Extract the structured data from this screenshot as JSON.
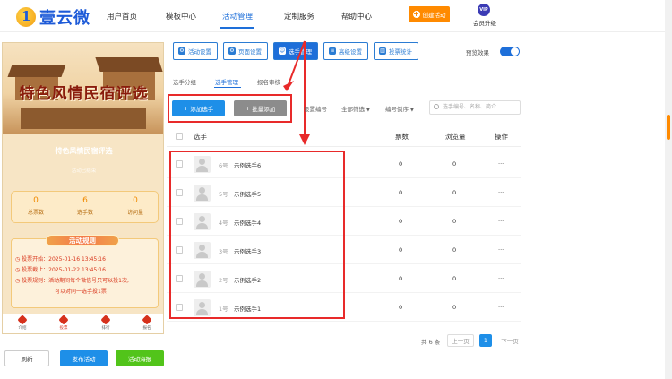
{
  "header": {
    "logo_text": "壹云微",
    "logo_mark": "1",
    "nav": [
      "用户首页",
      "模板中心",
      "活动管理",
      "定制服务",
      "帮助中心"
    ],
    "create_label": "创建活动",
    "vip_badge": "VIP",
    "vip_label": "会员升级"
  },
  "phone": {
    "banner_title": "特色风情民宿评选",
    "sub_title": "特色风情民宿评选",
    "sub_hint": "活动已结束",
    "stats": [
      {
        "num": "0",
        "label": "总票数"
      },
      {
        "num": "6",
        "label": "选手数"
      },
      {
        "num": "0",
        "label": "访问量"
      }
    ],
    "rules_title": "活动规则",
    "rules": [
      {
        "k": "投票开始：",
        "v": "2025-01-16 13:45:16"
      },
      {
        "k": "投票截止：",
        "v": "2025-01-22 13:45:16"
      },
      {
        "k": "投票规则：",
        "v": "活动期间每个微信号只可以投1次,"
      },
      {
        "k": "",
        "v": "可以对同一选手投1票"
      }
    ],
    "tabbar": [
      "介绍",
      "投票",
      "排行",
      "报名"
    ]
  },
  "bottom_buttons": {
    "refresh": "刷新",
    "publish": "发布活动",
    "poster": "活动海报"
  },
  "toolbar": {
    "buttons": [
      "活动设置",
      "页面设置",
      "选手管理",
      "高级设置",
      "投票统计"
    ],
    "preview_label": "预览效果"
  },
  "subtabs": [
    "选手分组",
    "选手管理",
    "报名审核"
  ],
  "actions": {
    "add": "添加选手",
    "batch_add": "批量添加"
  },
  "filters": {
    "sort": "设置编号",
    "group": "全部筛选",
    "order": "编号倒序",
    "search_placeholder": "选手编号、名称、简介"
  },
  "table": {
    "headers": {
      "player": "选手",
      "votes": "票数",
      "views": "浏览量",
      "ops": "操作"
    },
    "rows": [
      {
        "no": "6号",
        "name": "示例选手6",
        "votes": "0",
        "views": "0",
        "ops": "···"
      },
      {
        "no": "5号",
        "name": "示例选手5",
        "votes": "0",
        "views": "0",
        "ops": "···"
      },
      {
        "no": "4号",
        "name": "示例选手4",
        "votes": "0",
        "views": "0",
        "ops": "···"
      },
      {
        "no": "3号",
        "name": "示例选手3",
        "votes": "0",
        "views": "0",
        "ops": "···"
      },
      {
        "no": "2号",
        "name": "示例选手2",
        "votes": "0",
        "views": "0",
        "ops": "···"
      },
      {
        "no": "1号",
        "name": "示例选手1",
        "votes": "0",
        "views": "0",
        "ops": "···"
      }
    ]
  },
  "pagination": {
    "total": "共 6 条",
    "prev": "上一页",
    "current": "1",
    "next": "下一页"
  }
}
